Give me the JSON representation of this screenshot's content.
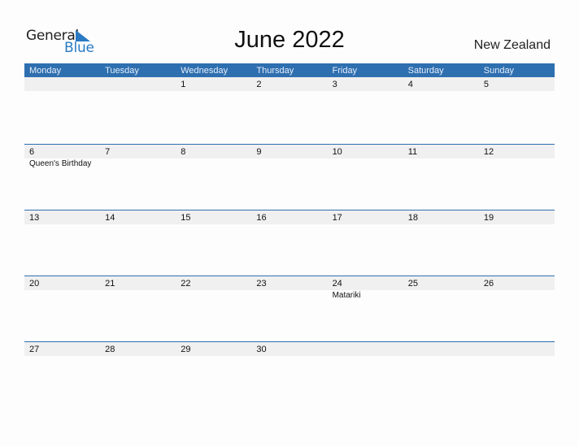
{
  "logo": {
    "word1": "General",
    "word2": "Blue",
    "brand_color": "#2a7ac4"
  },
  "title": "June 2022",
  "country": "New Zealand",
  "colors": {
    "header": "#2e6fb0",
    "date_strip": "#f0f0f0"
  },
  "weekdays": [
    "Monday",
    "Tuesday",
    "Wednesday",
    "Thursday",
    "Friday",
    "Saturday",
    "Sunday"
  ],
  "weeks": [
    {
      "days": [
        {
          "num": "",
          "event": ""
        },
        {
          "num": "",
          "event": ""
        },
        {
          "num": "1",
          "event": ""
        },
        {
          "num": "2",
          "event": ""
        },
        {
          "num": "3",
          "event": ""
        },
        {
          "num": "4",
          "event": ""
        },
        {
          "num": "5",
          "event": ""
        }
      ]
    },
    {
      "days": [
        {
          "num": "6",
          "event": "Queen's Birthday"
        },
        {
          "num": "7",
          "event": ""
        },
        {
          "num": "8",
          "event": ""
        },
        {
          "num": "9",
          "event": ""
        },
        {
          "num": "10",
          "event": ""
        },
        {
          "num": "11",
          "event": ""
        },
        {
          "num": "12",
          "event": ""
        }
      ]
    },
    {
      "days": [
        {
          "num": "13",
          "event": ""
        },
        {
          "num": "14",
          "event": ""
        },
        {
          "num": "15",
          "event": ""
        },
        {
          "num": "16",
          "event": ""
        },
        {
          "num": "17",
          "event": ""
        },
        {
          "num": "18",
          "event": ""
        },
        {
          "num": "19",
          "event": ""
        }
      ]
    },
    {
      "days": [
        {
          "num": "20",
          "event": ""
        },
        {
          "num": "21",
          "event": ""
        },
        {
          "num": "22",
          "event": ""
        },
        {
          "num": "23",
          "event": ""
        },
        {
          "num": "24",
          "event": "Matariki"
        },
        {
          "num": "25",
          "event": ""
        },
        {
          "num": "26",
          "event": ""
        }
      ]
    },
    {
      "days": [
        {
          "num": "27",
          "event": ""
        },
        {
          "num": "28",
          "event": ""
        },
        {
          "num": "29",
          "event": ""
        },
        {
          "num": "30",
          "event": ""
        },
        {
          "num": "",
          "event": ""
        },
        {
          "num": "",
          "event": ""
        },
        {
          "num": "",
          "event": ""
        }
      ]
    }
  ]
}
